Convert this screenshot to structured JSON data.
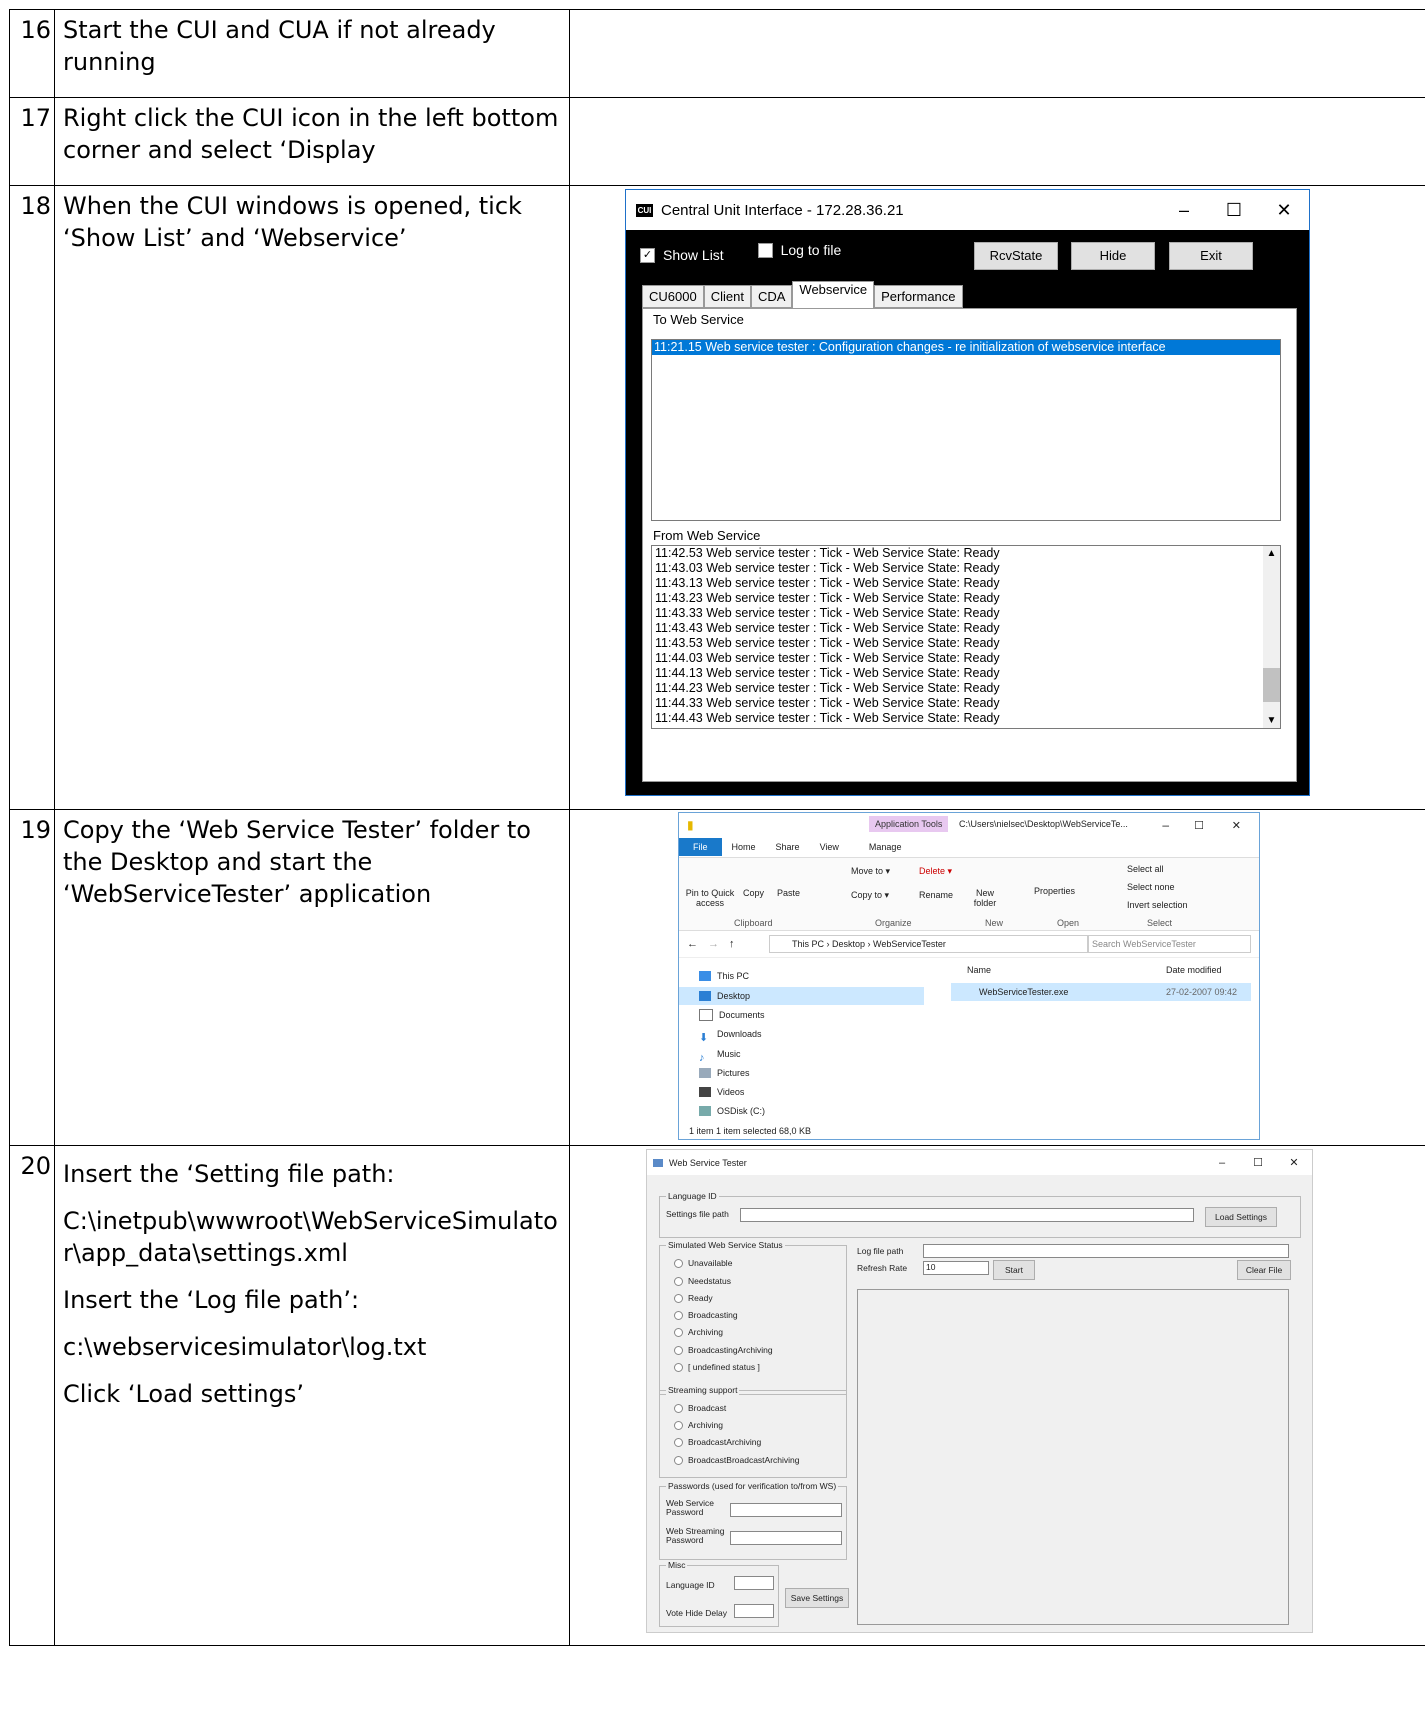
{
  "rows": [
    {
      "num": "16",
      "lines": [
        "Start the CUI and CUA if not already running"
      ]
    },
    {
      "num": "17",
      "lines": [
        "Right click the CUI icon in the left bottom corner and select ‘Display"
      ]
    },
    {
      "num": "18",
      "lines": [
        "When the CUI windows is opened, tick ‘Show List’ and ‘Webservice’"
      ]
    },
    {
      "num": "19",
      "lines": [
        "Copy the ‘Web Service Tester’ folder to the Desktop and start the ‘WebServiceTester’ application"
      ]
    },
    {
      "num": "20",
      "lines": [
        "Insert the ‘Setting file path:",
        "C:\\inetpub\\wwwroot\\WebServiceSimulator\\app_data\\settings.xml",
        "Insert the ‘Log file path’:",
        "c:\\webservicesimulator\\log.txt",
        "Click ‘Load settings’"
      ]
    }
  ],
  "cui": {
    "icon": "CUI",
    "title": "Central Unit Interface - 172.28.36.21",
    "show_list": "Show List",
    "log_to_file": "Log to file",
    "buttons": [
      "RcvState",
      "Hide",
      "Exit"
    ],
    "tabs": [
      "CU6000",
      "Client",
      "CDA",
      "Webservice",
      "Performance"
    ],
    "to_label": "To Web Service",
    "to_rows": [
      "11:21.15 Web service tester : Configuration changes - re initialization of webservice interface"
    ],
    "from_label": "From Web Service",
    "from_rows": [
      "11:42.53 Web service tester : Tick - Web Service State: Ready",
      "11:43.03 Web service tester : Tick - Web Service State: Ready",
      "11:43.13 Web service tester : Tick - Web Service State: Ready",
      "11:43.23 Web service tester : Tick - Web Service State: Ready",
      "11:43.33 Web service tester : Tick - Web Service State: Ready",
      "11:43.43 Web service tester : Tick - Web Service State: Ready",
      "11:43.53 Web service tester : Tick - Web Service State: Ready",
      "11:44.03 Web service tester : Tick - Web Service State: Ready",
      "11:44.13 Web service tester : Tick - Web Service State: Ready",
      "11:44.23 Web service tester : Tick - Web Service State: Ready",
      "11:44.33 Web service tester : Tick - Web Service State: Ready",
      "11:44.43 Web service tester : Tick - Web Service State: Ready"
    ]
  },
  "explorer": {
    "app_tools": "Application Tools",
    "path": "C:\\Users\\nielsec\\Desktop\\WebServiceTe...",
    "menu": [
      "File",
      "Home",
      "Share",
      "View",
      "Manage"
    ],
    "ribbon": {
      "pin": "Pin to Quick access",
      "copy": "Copy",
      "paste": "Paste",
      "move_to": "Move to ▾",
      "copy_to": "Copy to ▾",
      "delete": "Delete ▾",
      "rename": "Rename",
      "new_folder": "New folder",
      "properties": "Properties",
      "select_all": "Select all",
      "select_none": "Select none",
      "invert": "Invert selection",
      "groups": [
        "Clipboard",
        "Organize",
        "New",
        "Open",
        "Select"
      ]
    },
    "breadcrumb": [
      "This PC",
      "Desktop",
      "WebServiceTester"
    ],
    "search": "Search WebServiceTester",
    "nav": [
      "This PC",
      "Desktop",
      "Documents",
      "Downloads",
      "Music",
      "Pictures",
      "Videos",
      "OSDisk (C:)"
    ],
    "col_name": "Name",
    "col_date": "Date modified",
    "file_name": "WebServiceTester.exe",
    "file_date": "27-02-2007 09:42",
    "status": "1 item    1 item selected  68,0 KB"
  },
  "wst": {
    "title": "Web Service Tester",
    "lang_group": "Language ID",
    "settings_label": "Settings file path",
    "load_btn": "Load Settings",
    "sim_group": "Simulated Web Service Status",
    "sim_opts": [
      "Unavailable",
      "Needstatus",
      "Ready",
      "Broadcasting",
      "Archiving",
      "BroadcastingArchiving",
      "[ undefined status ]"
    ],
    "stream_group": "Streaming support",
    "stream_opts": [
      "Broadcast",
      "Archiving",
      "BroadcastArchiving",
      "BroadcastBroadcastArchiving"
    ],
    "pw_group": "Passwords (used for verification to/from WS)",
    "ws_pw_1": "Web Service",
    "ws_pw_2": "Password",
    "wss_pw_1": "Web Streaming",
    "wss_pw_2": "Password",
    "misc_group": "Misc",
    "lang_id": "Language ID",
    "vote_hide": "Vote Hide Delay",
    "save_btn": "Save Settings",
    "log_path": "Log file path",
    "refresh": "Refresh Rate",
    "refresh_val": "10",
    "start_btn": "Start",
    "clear_btn": "Clear File"
  }
}
